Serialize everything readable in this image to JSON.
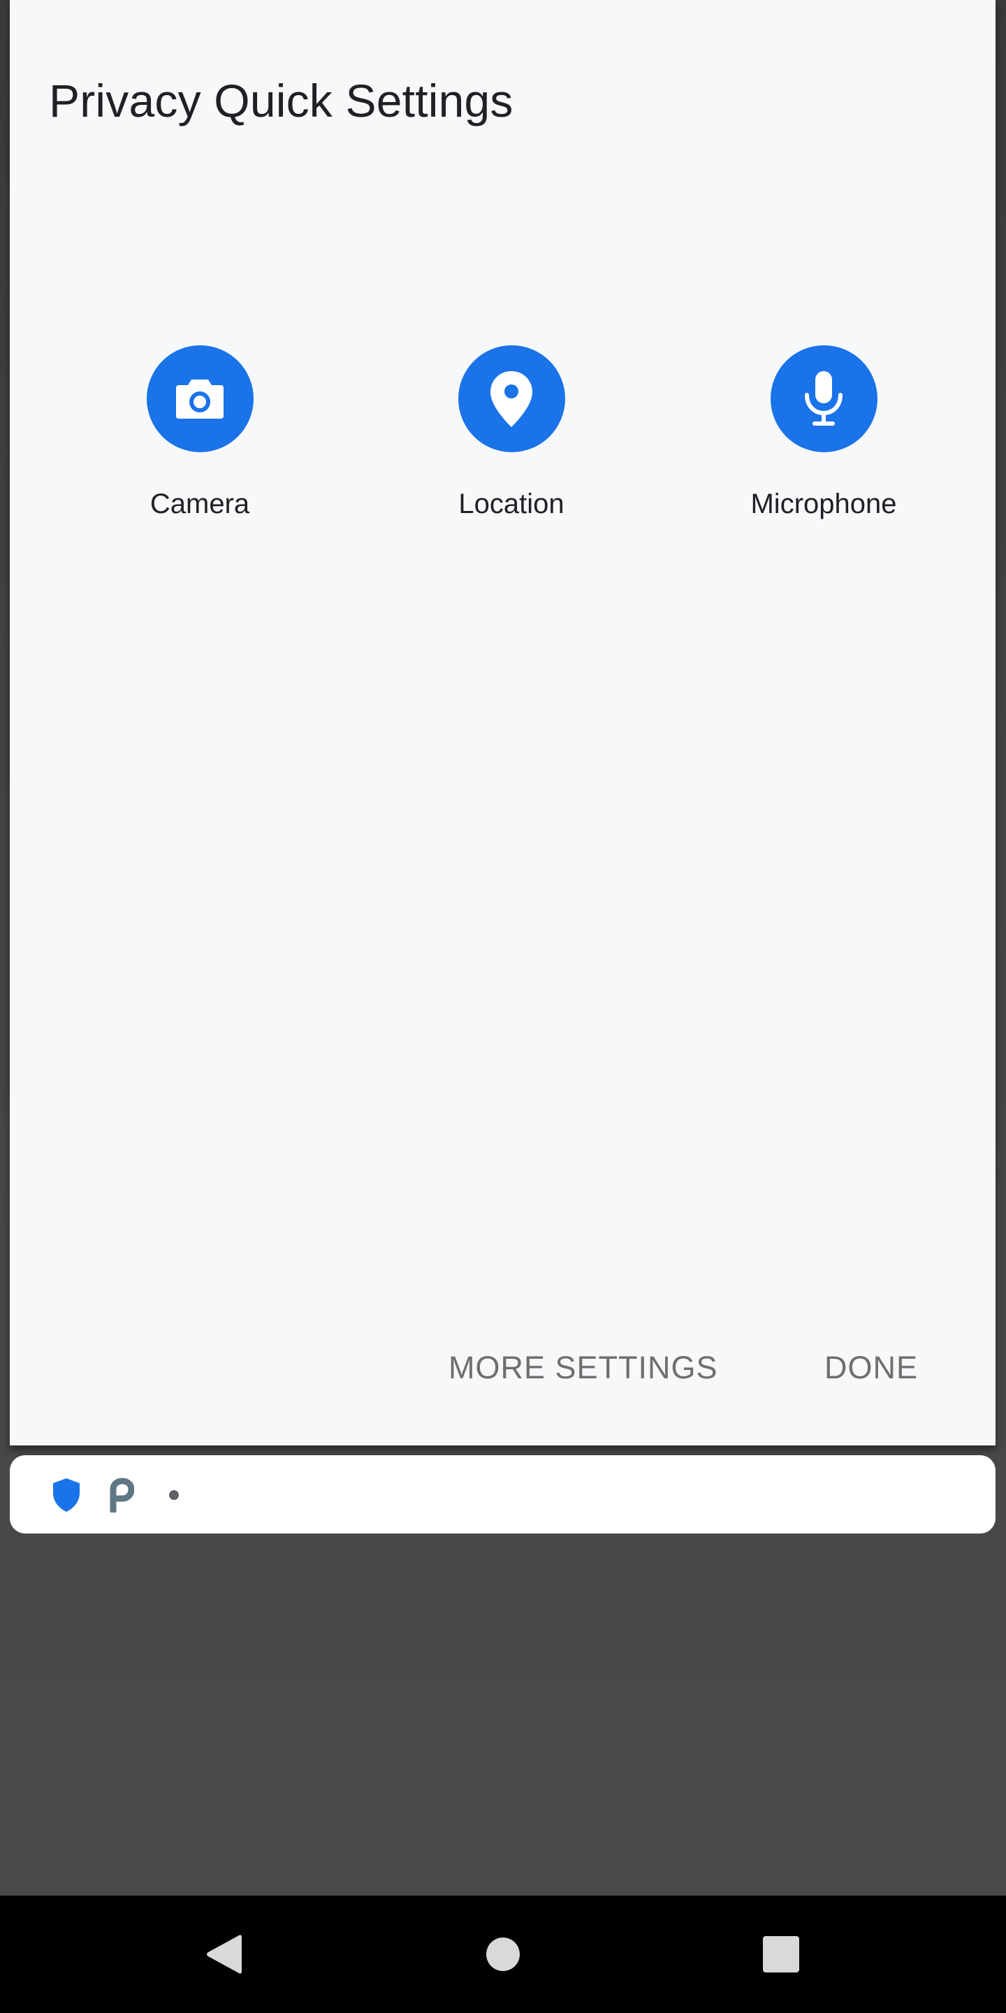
{
  "dialog": {
    "title": "Privacy Quick Settings",
    "tiles": [
      {
        "label": "Camera",
        "icon": "camera-icon"
      },
      {
        "label": "Location",
        "icon": "location-pin-icon"
      },
      {
        "label": "Microphone",
        "icon": "microphone-icon"
      }
    ],
    "buttons": {
      "more_settings": "MORE SETTINGS",
      "done": "DONE"
    }
  },
  "notification_strip": {
    "icons": [
      "shield-icon",
      "p-app-icon",
      "more-dot-icon"
    ]
  },
  "navigation_bar": {
    "buttons": [
      "back-icon",
      "home-icon",
      "recents-icon"
    ]
  },
  "colors": {
    "accent": "#1a73e8",
    "dialog_background": "#f7f8fa",
    "title_text": "#202124",
    "button_text": "#6f6f6f",
    "backdrop": "#474747",
    "navbar": "#000000",
    "shield": "#1a73e8",
    "p_icon": "#5f7785"
  }
}
